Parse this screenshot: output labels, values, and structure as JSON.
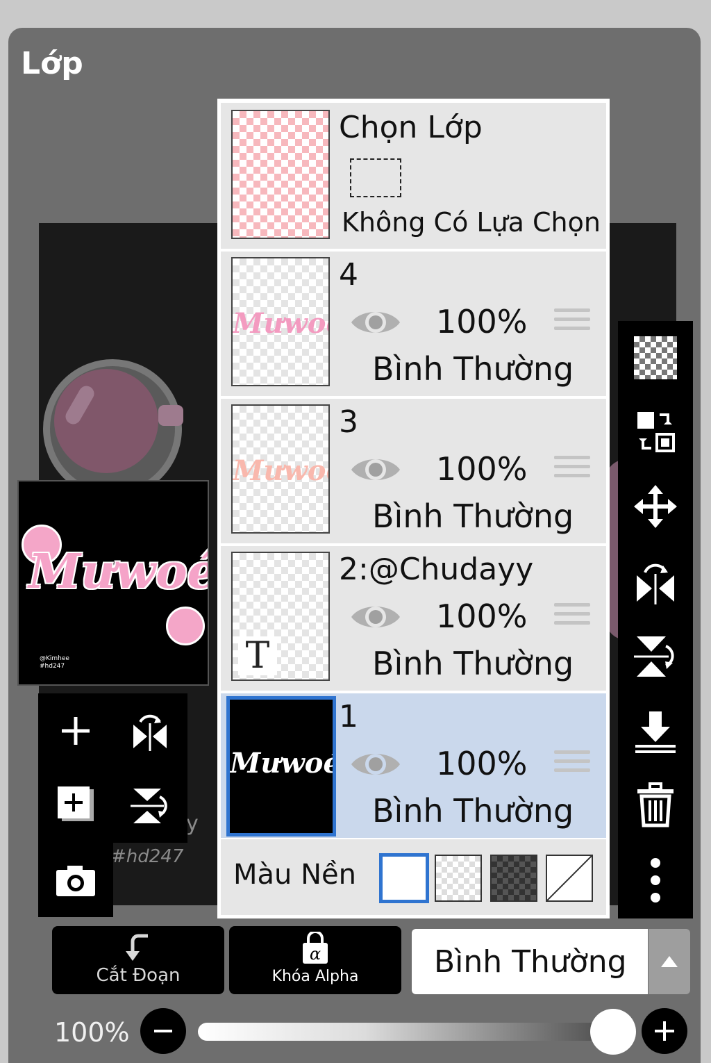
{
  "panel": {
    "title": "Lớp"
  },
  "preview": {
    "art_text": "Mưwoé",
    "small_text_1": "@Kimhee",
    "small_text_2": "#hd247"
  },
  "watermark": {
    "tag": "#hd247",
    "tail": "y"
  },
  "selection": {
    "title": "Chọn Lớp",
    "status": "Không Có Lựa Chọn"
  },
  "layers": [
    {
      "name": "4",
      "opacity": "100%",
      "blend": "Bình Thường",
      "visible": true,
      "selected": false,
      "thumb_text": "Mưwoé",
      "thumb_color": "#f39bc0"
    },
    {
      "name": "3",
      "opacity": "100%",
      "blend": "Bình Thường",
      "visible": true,
      "selected": false,
      "thumb_text": "Mưwoé",
      "thumb_color": "#f9b8ad"
    },
    {
      "name": "2:@Chudayy",
      "opacity": "100%",
      "blend": "Bình Thường",
      "visible": true,
      "selected": false,
      "thumb_glyph": "T"
    },
    {
      "name": "1",
      "opacity": "100%",
      "blend": "Bình Thường",
      "visible": true,
      "selected": true,
      "thumb_text": "Mưwoé",
      "thumb_color": "#ffffff"
    }
  ],
  "background": {
    "label": "Màu Nền",
    "options": [
      "white",
      "transparent-light",
      "transparent-dark",
      "none"
    ],
    "selected": "white"
  },
  "bottom": {
    "clip_label": "Cắt Đoạn",
    "alpha_lock_label": "Khóa Alpha",
    "blend_mode": "Bình Thường",
    "opacity_label": "100%",
    "opacity_value": 1.0
  },
  "icons": {
    "left_tools": [
      "plus-icon",
      "flip-horizontal-icon",
      "add-layer-icon",
      "flip-vertical-icon",
      "camera-icon"
    ],
    "right_tools": [
      "checker-icon",
      "swap-icon",
      "move-icon",
      "flip-horizontal-icon",
      "flip-vertical-icon",
      "merge-down-icon",
      "trash-icon",
      "more-icon"
    ]
  },
  "colors": {
    "accent": "#2f74d0",
    "selected_row": "#cad8ec",
    "panel_bg": "#6e6e6e"
  }
}
